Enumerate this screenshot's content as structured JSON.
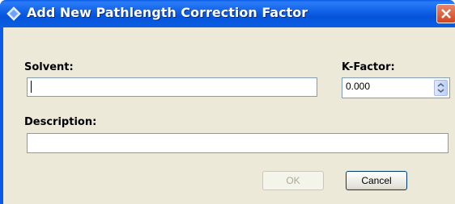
{
  "window": {
    "title": "Add New Pathlength Correction Factor"
  },
  "form": {
    "solvent_label": "Solvent:",
    "solvent_value": "",
    "kfactor_label": "K-Factor:",
    "kfactor_value": "0.000",
    "description_label": "Description:",
    "description_value": ""
  },
  "buttons": {
    "ok_label": "OK",
    "cancel_label": "Cancel"
  },
  "icons": {
    "title_icon": "app-icon",
    "close_icon": "close-icon",
    "spinner_icon": "spinner-arrows-icon"
  },
  "colors": {
    "titlebar": "#0a5ce8",
    "client_bg": "#ece9d8",
    "close": "#d1451e"
  }
}
